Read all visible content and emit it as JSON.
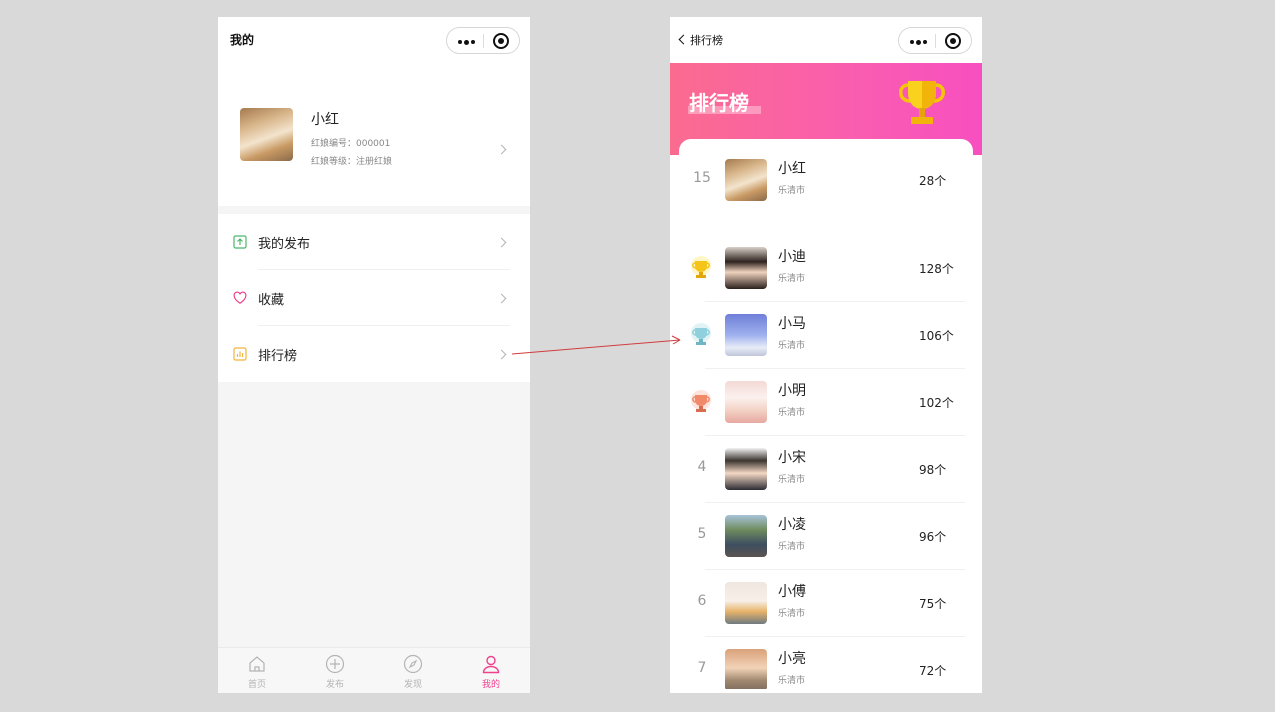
{
  "left": {
    "nav_title": "我的",
    "profile": {
      "name": "小红",
      "id_line": "红娘编号：000001",
      "level_line": "红娘等级：注册红娘",
      "avatar_icon": "dog-avatar"
    },
    "menu": [
      {
        "label": "我的发布",
        "icon": "upload-icon",
        "color": "#4cb86a"
      },
      {
        "label": "收藏",
        "icon": "heart-icon",
        "color": "#f0418d"
      },
      {
        "label": "排行榜",
        "icon": "chart-icon",
        "color": "#f2b441"
      }
    ],
    "tabbar": [
      {
        "label": "首页",
        "icon": "home-icon"
      },
      {
        "label": "发布",
        "icon": "plus-circle-icon"
      },
      {
        "label": "发现",
        "icon": "compass-icon"
      },
      {
        "label": "我的",
        "icon": "user-icon",
        "active": true
      }
    ]
  },
  "right": {
    "nav_title": "排行榜",
    "banner_title": "排行榜",
    "accent": "#f95db0",
    "mine": {
      "rank": "15",
      "name": "小红",
      "city": "乐清市",
      "count": "28个",
      "avatar": "dog-avatar"
    },
    "list": [
      {
        "rank": "1",
        "medal": "gold-medal-icon",
        "name": "小迪",
        "city": "乐清市",
        "count": "128个"
      },
      {
        "rank": "2",
        "medal": "silver-medal-icon",
        "name": "小马",
        "city": "乐清市",
        "count": "106个"
      },
      {
        "rank": "3",
        "medal": "bronze-medal-icon",
        "name": "小明",
        "city": "乐清市",
        "count": "102个"
      },
      {
        "rank": "4",
        "name": "小宋",
        "city": "乐清市",
        "count": "98个"
      },
      {
        "rank": "5",
        "name": "小凌",
        "city": "乐清市",
        "count": "96个"
      },
      {
        "rank": "6",
        "name": "小傅",
        "city": "乐清市",
        "count": "75个"
      },
      {
        "rank": "7",
        "name": "小亮",
        "city": "乐清市",
        "count": "72个"
      }
    ]
  }
}
